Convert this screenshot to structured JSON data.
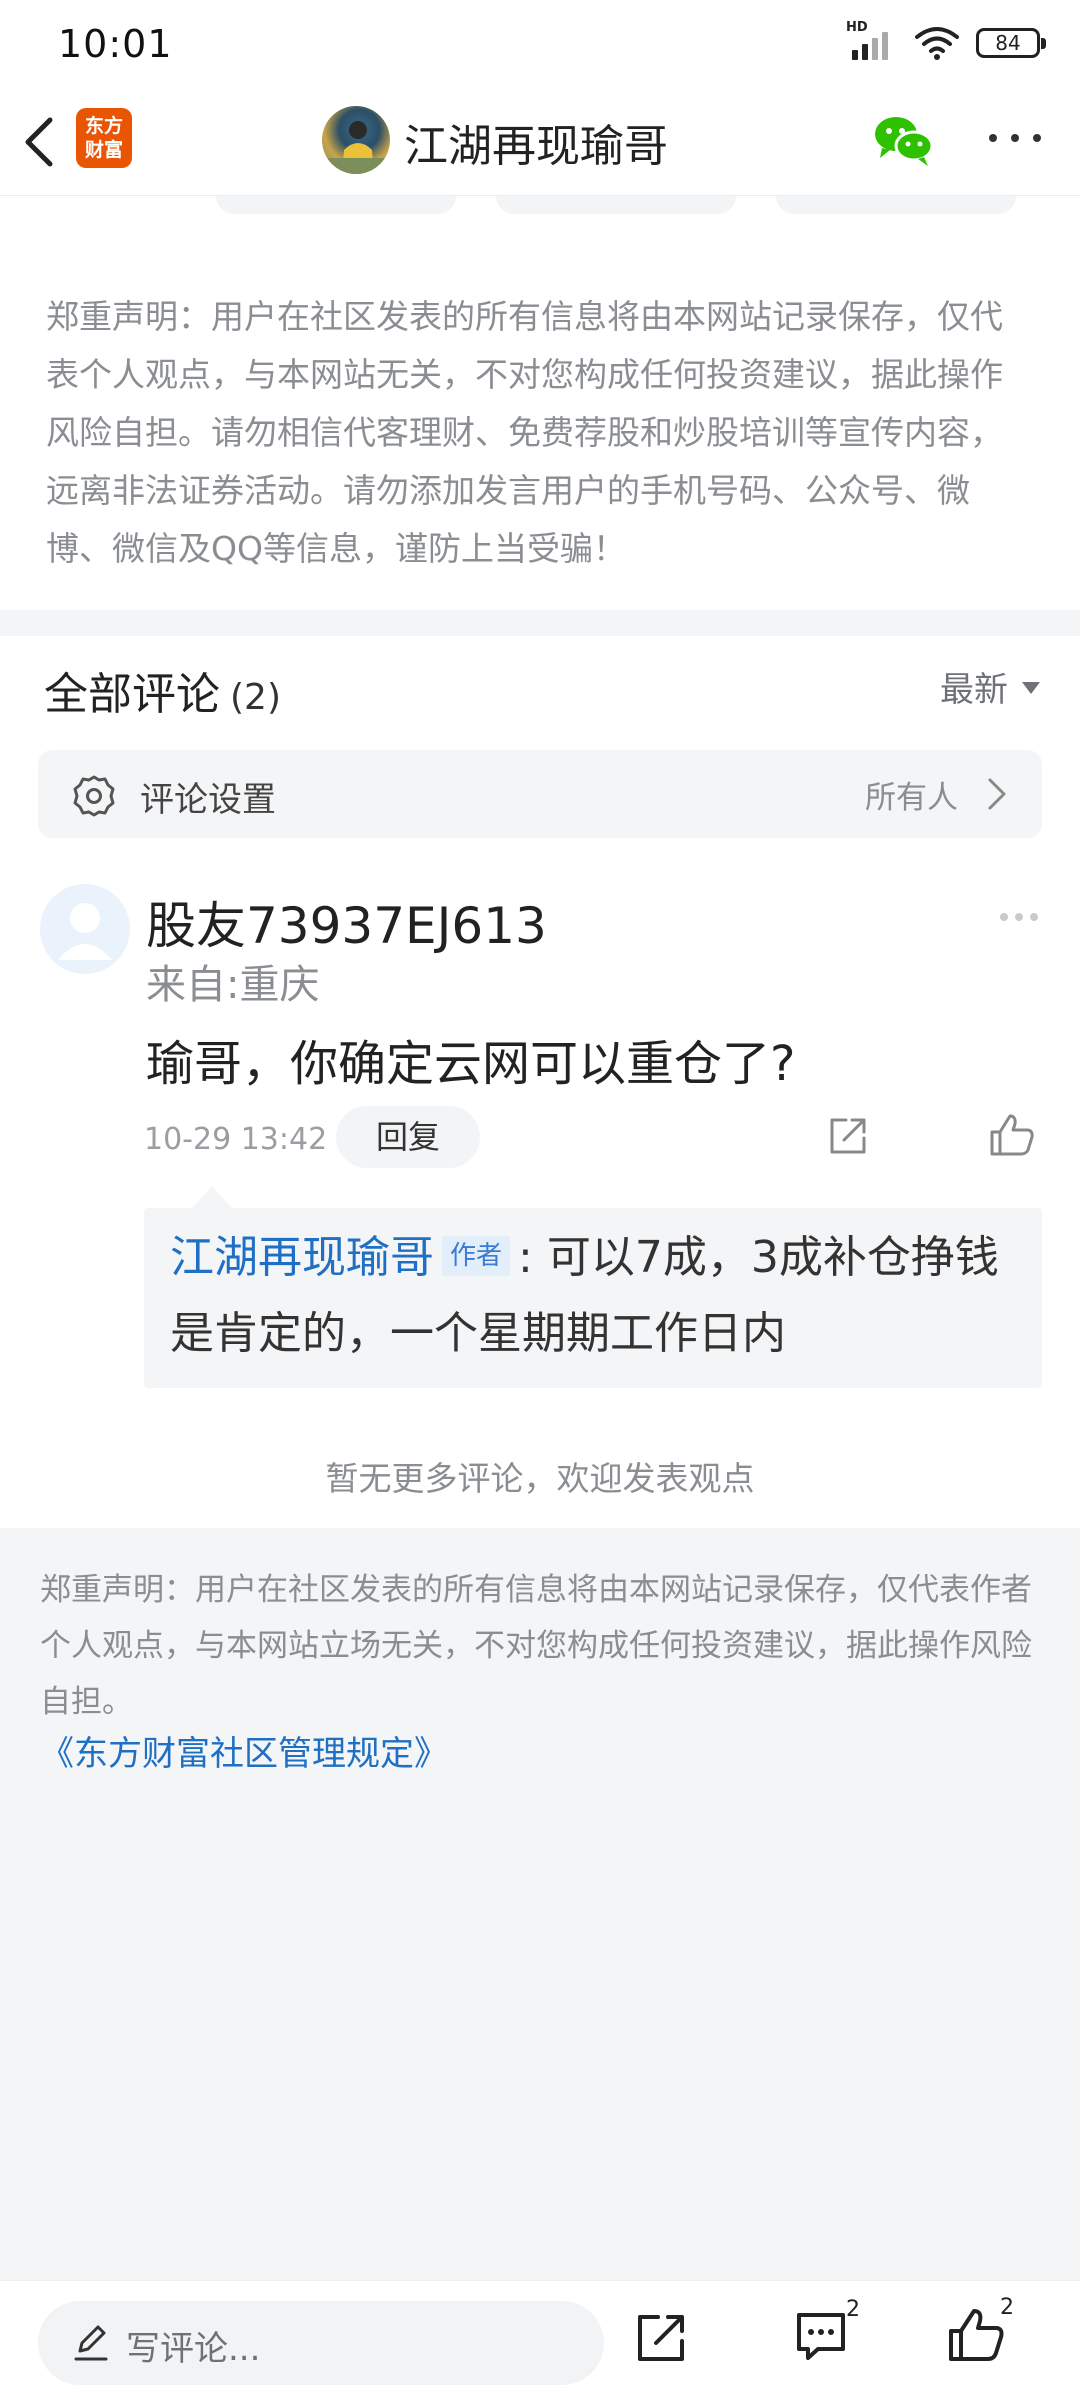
{
  "status_bar": {
    "time": "10:01",
    "hd_label": "HD",
    "battery": "84"
  },
  "nav": {
    "title": "江湖再现瑜哥",
    "app_logo_line1": "东方",
    "app_logo_line2": "财富"
  },
  "disclaimer_top": "郑重声明：用户在社区发表的所有信息将由本网站记录保存，仅代表个人观点，与本网站无关，不对您构成任何投资建议，据此操作风险自担。请勿相信代客理财、免费荐股和炒股培训等宣传内容，远离非法证券活动。请勿添加发言用户的手机号码、公众号、微博、微信及QQ等信息，谨防上当受骗！",
  "comments": {
    "section_title": "全部评论",
    "count": "(2)",
    "sort_label": "最新",
    "settings": {
      "label": "评论设置",
      "value": "所有人"
    },
    "items": [
      {
        "username": "股友73937EJ613",
        "location": "来自:重庆",
        "text": "瑜哥，你确定云网可以重仓了?",
        "time": "10-29 13:42",
        "reply_label": "回复",
        "reply": {
          "author": "江湖再现瑜哥",
          "author_tag": "作者",
          "text": ": 可以7成，3成补仓挣钱是肯定的，一个星期期工作日内"
        }
      }
    ],
    "no_more": "暂无更多评论，欢迎发表观点"
  },
  "disclaimer_bottom": "郑重声明：用户在社区发表的所有信息将由本网站记录保存，仅代表作者个人观点，与本网站立场无关，不对您构成任何投资建议，据此操作风险自担。",
  "rules_link": "《东方财富社区管理规定》",
  "bottom_bar": {
    "input_placeholder": "写评论...",
    "comment_count": "2",
    "like_count": "2"
  },
  "colors": {
    "brand_orange": "#ea5504",
    "link_blue": "#1f6fc4",
    "wechat_green": "#2dc100"
  }
}
